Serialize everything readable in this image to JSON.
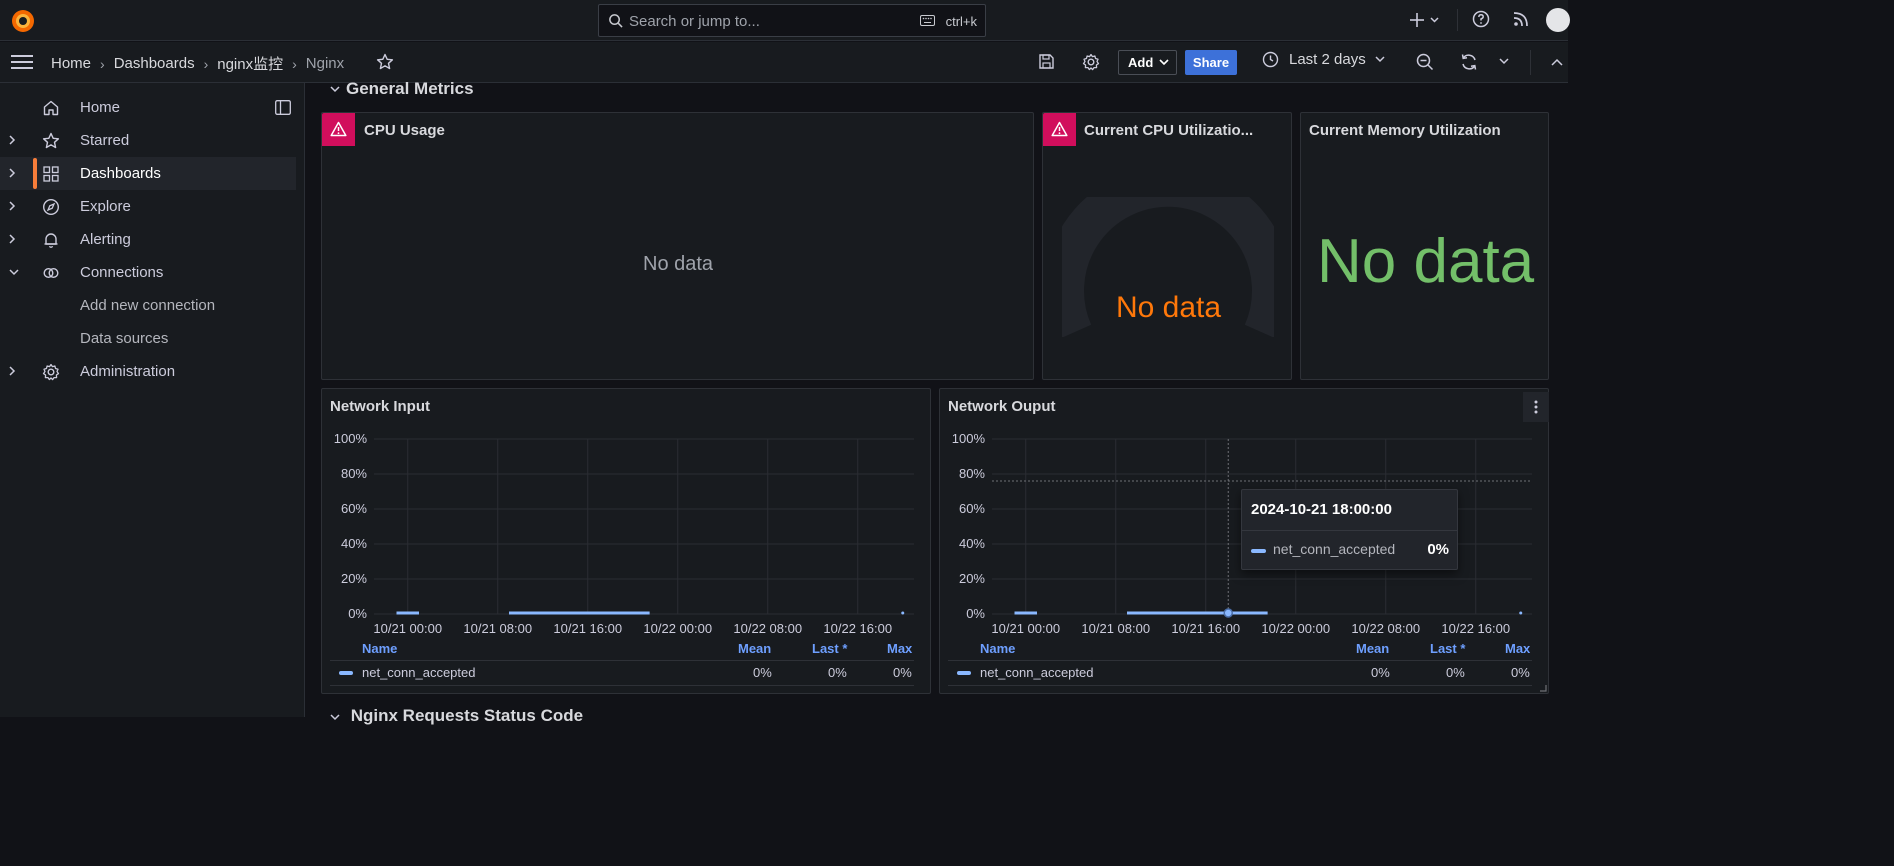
{
  "topbar": {
    "search_placeholder": "Search or jump to...",
    "search_shortcut": "ctrl+k"
  },
  "navbar": {
    "breadcrumbs": [
      "Home",
      "Dashboards",
      "nginx监控",
      "Nginx"
    ],
    "add_label": "Add",
    "share_label": "Share",
    "time_range": "Last 2 days"
  },
  "sidebar": {
    "items": [
      {
        "label": "Home"
      },
      {
        "label": "Starred"
      },
      {
        "label": "Dashboards"
      },
      {
        "label": "Explore"
      },
      {
        "label": "Alerting"
      },
      {
        "label": "Connections"
      },
      {
        "label": "Add new connection"
      },
      {
        "label": "Data sources"
      },
      {
        "label": "Administration"
      }
    ]
  },
  "colors": {
    "accent_orange": "#f77d3a",
    "share_blue": "#3d71d9",
    "warn_pink": "#d10e5c",
    "gauge_nodata": "#ff780a",
    "stat_nodata": "#73bf69",
    "series_blue": "#8ab8ff"
  },
  "dashboard": {
    "row_title": "General Metrics",
    "next_row_title": "Nginx Requests Status Code",
    "panels": {
      "cpu_usage": {
        "title": "CPU Usage",
        "message": "No data"
      },
      "cpu_util": {
        "title": "Current CPU Utilizatio...",
        "message": "No data"
      },
      "mem_util": {
        "title": "Current Memory Utilization",
        "message": "No data"
      },
      "net_input": {
        "title": "Network Input",
        "legend": {
          "headers": [
            "Name",
            "Mean",
            "Last *",
            "Max"
          ],
          "series": "net_conn_accepted",
          "mean": "0%",
          "last": "0%",
          "max": "0%"
        }
      },
      "net_output": {
        "title": "Network Ouput",
        "legend": {
          "headers": [
            "Name",
            "Mean",
            "Last *",
            "Max"
          ],
          "series": "net_conn_accepted",
          "mean": "0%",
          "last": "0%",
          "max": "0%"
        },
        "tooltip": {
          "time": "2024-10-21 18:00:00",
          "series": "net_conn_accepted",
          "value": "0%"
        }
      }
    }
  },
  "chart_data": [
    {
      "type": "line",
      "title": "Network Input",
      "y_ticks": [
        "100%",
        "80%",
        "60%",
        "40%",
        "20%",
        "0%"
      ],
      "x_ticks": [
        "10/21 00:00",
        "10/21 08:00",
        "10/21 16:00",
        "10/22 00:00",
        "10/22 08:00",
        "10/22 16:00"
      ],
      "ylim": [
        0,
        100
      ],
      "series": [
        {
          "name": "net_conn_accepted",
          "segments": [
            [
              "10/20 23:00",
              "10/21 01:00",
              0
            ],
            [
              "10/21 09:00",
              "10/21 21:30",
              0
            ],
            [
              "10/22 20:00",
              "10/22 20:00",
              0
            ]
          ]
        }
      ]
    },
    {
      "type": "line",
      "title": "Network Ouput",
      "y_ticks": [
        "100%",
        "80%",
        "60%",
        "40%",
        "20%",
        "0%"
      ],
      "x_ticks": [
        "10/21 00:00",
        "10/21 08:00",
        "10/21 16:00",
        "10/22 00:00",
        "10/22 08:00",
        "10/22 16:00"
      ],
      "ylim": [
        0,
        100
      ],
      "series": [
        {
          "name": "net_conn_accepted",
          "segments": [
            [
              "10/20 23:00",
              "10/21 01:00",
              0
            ],
            [
              "10/21 09:00",
              "10/21 21:30",
              0
            ],
            [
              "10/22 20:00",
              "10/22 20:00",
              0
            ]
          ]
        }
      ]
    }
  ]
}
